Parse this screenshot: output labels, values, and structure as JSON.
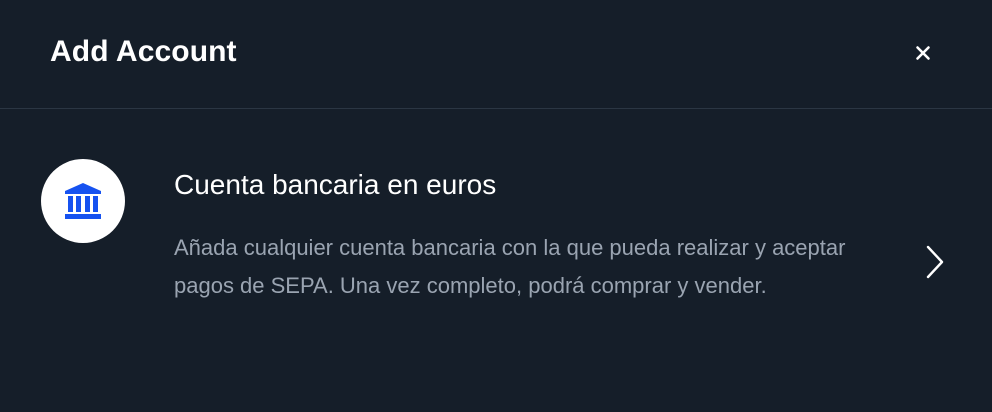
{
  "header": {
    "title": "Add Account"
  },
  "option": {
    "title": "Cuenta bancaria en euros",
    "description": "Añada cualquier cuenta bancaria con la que pueda realizar y aceptar pagos de SEPA. Una vez completo, podrá comprar y vender.",
    "icon": "bank-icon"
  },
  "colors": {
    "background": "#151e29",
    "accent": "#1652f0",
    "muted_text": "#9aa4b1",
    "divider": "#2b3643"
  }
}
